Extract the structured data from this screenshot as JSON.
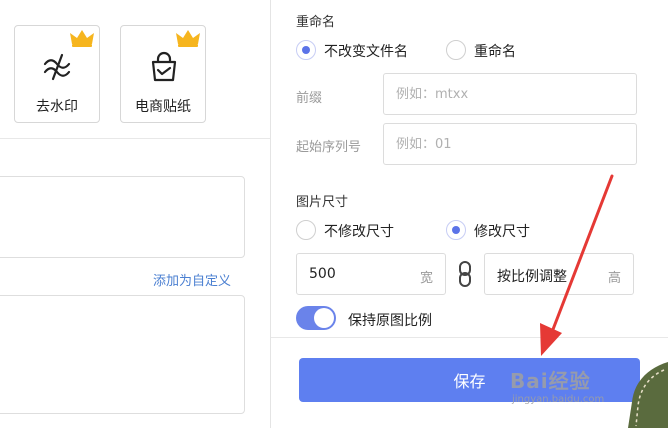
{
  "tools": [
    {
      "label": "去水印",
      "icon": "remove-watermark-icon",
      "badge": "crown-icon"
    },
    {
      "label": "电商贴纸",
      "icon": "shopping-bag-icon",
      "badge": "crown-icon"
    }
  ],
  "left": {
    "add_custom_link": "添加为自定义"
  },
  "rename": {
    "title": "重命名",
    "options": [
      {
        "label": "不改变文件名",
        "checked": true
      },
      {
        "label": "重命名",
        "checked": false
      }
    ],
    "prefix": {
      "label": "前缀",
      "placeholder": "例如：mtxx"
    },
    "start_number": {
      "label": "起始序列号",
      "placeholder": "例如：01"
    }
  },
  "image_size": {
    "title": "图片尺寸",
    "options": [
      {
        "label": "不修改尺寸",
        "checked": false
      },
      {
        "label": "修改尺寸",
        "checked": true
      }
    ],
    "width": {
      "value": "500",
      "unit": "宽"
    },
    "height": {
      "value": "按比例调整",
      "unit": "高"
    },
    "keep_ratio": {
      "label": "保持原图比例",
      "on": true
    }
  },
  "save_label": "保存",
  "watermark": {
    "main": "Bai经验",
    "sub": "jingyan.baidu.com"
  },
  "colors": {
    "accent": "#5e7ff0",
    "radio": "#5b73e8",
    "link": "#4a7fd1",
    "annotation_arrow": "#e53935"
  }
}
